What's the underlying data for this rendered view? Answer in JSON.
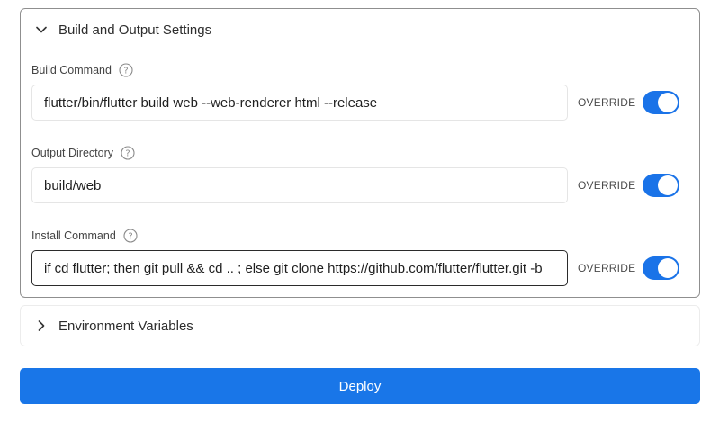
{
  "build_section": {
    "title": "Build and Output Settings",
    "expanded": true,
    "fields": [
      {
        "label": "Build Command",
        "value": "flutter/bin/flutter build web --web-renderer html --release",
        "override_label": "OVERRIDE",
        "override_enabled": true
      },
      {
        "label": "Output Directory",
        "value": "build/web",
        "override_label": "OVERRIDE",
        "override_enabled": true
      },
      {
        "label": "Install Command",
        "value": "if cd flutter; then git pull && cd .. ; else git clone https://github.com/flutter/flutter.git -b",
        "override_label": "OVERRIDE",
        "override_enabled": true
      }
    ]
  },
  "env_section": {
    "title": "Environment Variables",
    "expanded": false
  },
  "deploy_button": {
    "label": "Deploy"
  },
  "colors": {
    "accent": "#1976e8",
    "toggle_on": "#1a73e8",
    "panel_border": "#8f8f8f"
  },
  "icons": {
    "expanded_chevron": "chevron-down-icon",
    "collapsed_chevron": "chevron-right-icon",
    "help": "question-circle-icon"
  }
}
